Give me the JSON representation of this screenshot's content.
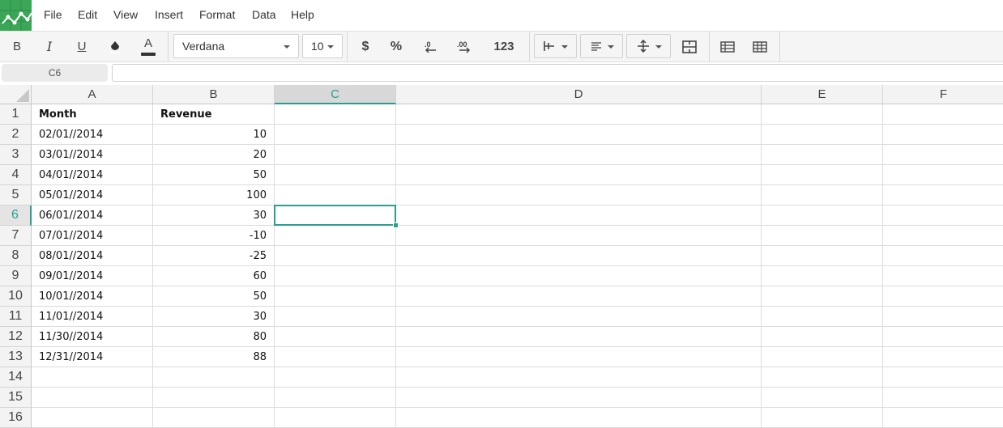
{
  "menu": {
    "items": [
      {
        "id": "file",
        "label": "File"
      },
      {
        "id": "edit",
        "label": "Edit"
      },
      {
        "id": "view",
        "label": "View"
      },
      {
        "id": "insert",
        "label": "Insert"
      },
      {
        "id": "format",
        "label": "Format"
      },
      {
        "id": "data",
        "label": "Data"
      },
      {
        "id": "help",
        "label": "Help"
      }
    ]
  },
  "toolbar": {
    "bold_label": "B",
    "italic_label": "I",
    "underline_label": "U",
    "text_color_label": "A",
    "font_family": "Verdana",
    "font_size": "10",
    "currency_label": "$",
    "percent_label": "%",
    "number_format_label": "123",
    "fill_color": "#333333",
    "text_color": "#333333"
  },
  "formula_bar": {
    "cell_ref": "C6",
    "formula": ""
  },
  "sheet": {
    "columns": [
      "A",
      "B",
      "C",
      "D",
      "E",
      "F"
    ],
    "rows": [
      "1",
      "2",
      "3",
      "4",
      "5",
      "6",
      "7",
      "8",
      "9",
      "10",
      "11",
      "12",
      "13",
      "14",
      "15",
      "16"
    ],
    "active_column": "C",
    "active_row": "6",
    "cells": [
      [
        "Month",
        "Revenue"
      ],
      [
        "02/01//2014",
        "10"
      ],
      [
        "03/01//2014",
        "20"
      ],
      [
        "04/01//2014",
        "50"
      ],
      [
        "05/01//2014",
        "100"
      ],
      [
        "06/01//2014",
        "30"
      ],
      [
        "07/01//2014",
        "-10"
      ],
      [
        "08/01//2014",
        "-25"
      ],
      [
        "09/01//2014",
        "60"
      ],
      [
        "10/01//2014",
        "50"
      ],
      [
        "11/01//2014",
        "30"
      ],
      [
        "11/30//2014",
        "80"
      ],
      [
        "12/31//2014",
        "88"
      ]
    ],
    "accent_color": "#2a9d8f"
  }
}
